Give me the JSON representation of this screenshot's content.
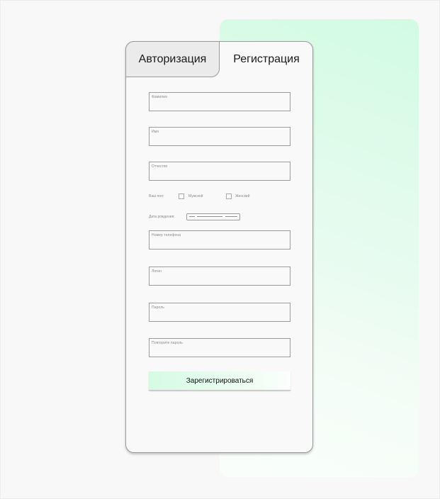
{
  "tabs": {
    "login_label": "Авторизация",
    "register_label": "Регистрация"
  },
  "form": {
    "last_name_placeholder": "Фамилия",
    "first_name_placeholder": "Имя",
    "patronymic_placeholder": "Отчество",
    "gender": {
      "label": "Ваш пол:",
      "male_label": "Мужской",
      "female_label": "Женский"
    },
    "birth_date_label": "Дата рождения:",
    "phone_placeholder": "Номер телефона",
    "login_placeholder": "Логин",
    "password_placeholder": "Пароль",
    "password_repeat_placeholder": "Повторите пароль",
    "submit_label": "Зарегистрироваться"
  },
  "colors": {
    "accent_gradient_start": "#d2fbe2",
    "accent_gradient_end": "#fafefb",
    "card_border": "#9a9a9a",
    "login_tab_bg": "#ebebeb"
  }
}
